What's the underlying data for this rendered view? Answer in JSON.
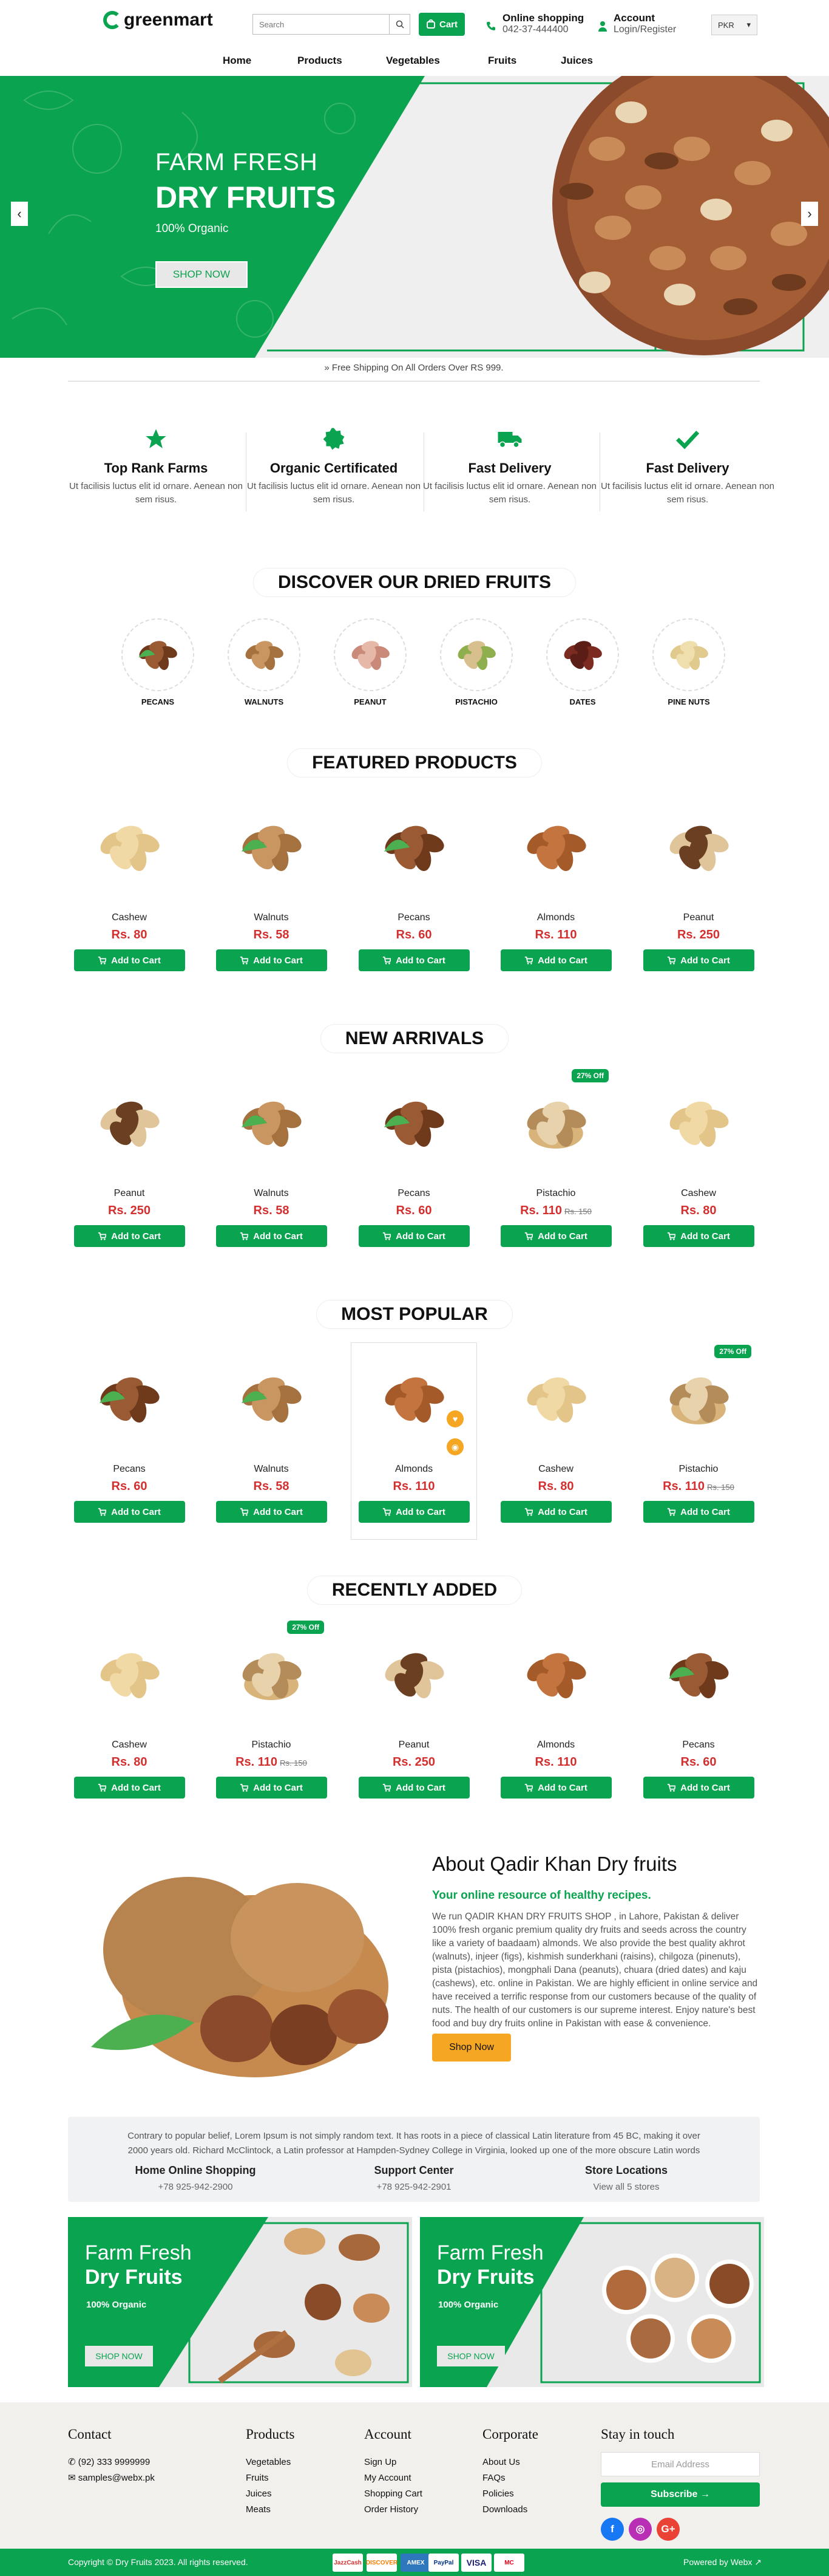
{
  "header": {
    "logo": "greenmart",
    "search_placeholder": "Search",
    "cart_label": "Cart",
    "phone_title": "Online shopping",
    "phone_number": "042-37-444400",
    "account_title": "Account",
    "account_sub": "Login/Register",
    "currency": "PKR"
  },
  "nav": [
    "Home",
    "Products",
    "Vegetables",
    "Fruits",
    "Juices"
  ],
  "hero": {
    "small": "FARM FRESH",
    "big": "DRY FRUITS",
    "sub": "100% Organic",
    "shop": "SHOP NOW"
  },
  "shipping": "» Free Shipping On All Orders Over RS 999.",
  "features": [
    {
      "title": "Top Rank Farms",
      "text": "Ut facilisis luctus elit id ornare. Aenean non sem risus.",
      "icon": "star-icon"
    },
    {
      "title": "Organic Certificated",
      "text": "Ut facilisis luctus elit id ornare. Aenean non sem risus.",
      "icon": "certificate-icon"
    },
    {
      "title": "Fast Delivery",
      "text": "Ut facilisis luctus elit id ornare. Aenean non sem risus.",
      "icon": "truck-icon"
    },
    {
      "title": "Fast Delivery",
      "text": "Ut facilisis luctus elit id ornare. Aenean non sem risus.",
      "icon": "check-icon"
    }
  ],
  "sections": {
    "discover": "DISCOVER OUR DRIED FRUITS",
    "featured": "FEATURED PRODUCTS",
    "new": "NEW ARRIVALS",
    "popular": "MOST POPULAR",
    "recent": "RECENTLY ADDED"
  },
  "categories": [
    "PECANS",
    "WALNUTS",
    "PEANUT",
    "PISTACHIO",
    "DATES",
    "PINE NUTS"
  ],
  "add_to_cart": "Add to Cart",
  "featured": [
    {
      "name": "Cashew",
      "price": "Rs. 80"
    },
    {
      "name": "Walnuts",
      "price": "Rs. 58"
    },
    {
      "name": "Pecans",
      "price": "Rs. 60"
    },
    {
      "name": "Almonds",
      "price": "Rs. 110"
    },
    {
      "name": "Peanut",
      "price": "Rs. 250"
    }
  ],
  "new_arrivals": [
    {
      "name": "Peanut",
      "price": "Rs. 250"
    },
    {
      "name": "Walnuts",
      "price": "Rs. 58"
    },
    {
      "name": "Pecans",
      "price": "Rs. 60"
    },
    {
      "name": "Pistachio",
      "price": "Rs. 110",
      "old": "Rs. 150",
      "badge": "27% Off"
    },
    {
      "name": "Cashew",
      "price": "Rs. 80"
    }
  ],
  "popular": [
    {
      "name": "Pecans",
      "price": "Rs. 60"
    },
    {
      "name": "Walnuts",
      "price": "Rs. 58"
    },
    {
      "name": "Almonds",
      "price": "Rs. 110"
    },
    {
      "name": "Cashew",
      "price": "Rs. 80"
    },
    {
      "name": "Pistachio",
      "price": "Rs. 110",
      "old": "Rs. 150",
      "badge": "27% Off"
    }
  ],
  "recent": [
    {
      "name": "Cashew",
      "price": "Rs. 80"
    },
    {
      "name": "Pistachio",
      "price": "Rs. 110",
      "old": "Rs. 150",
      "badge": "27% Off"
    },
    {
      "name": "Peanut",
      "price": "Rs. 250"
    },
    {
      "name": "Almonds",
      "price": "Rs. 110"
    },
    {
      "name": "Pecans",
      "price": "Rs. 60"
    }
  ],
  "about": {
    "title": "About Qadir Khan Dry fruits",
    "subtitle": "Your online resource of healthy recipes.",
    "body": "We run QADIR KHAN DRY FRUITS SHOP , in Lahore, Pakistan & deliver 100% fresh organic premium quality dry fruits and seeds across the country like a variety of baadaam) almonds. We also provide the best quality akhrot (walnuts), injeer (figs), kishmish sunderkhani (raisins), chilgoza (pinenuts), pista (pistachios), mongphali Dana (peanuts), chuara (dried dates) and kaju (cashews), etc. online in Pakistan. We are highly efficient in online service and have received a terrific response from our customers because of the quality of nuts. The health of our customers is our supreme interest. Enjoy nature's best food and buy dry fruits online in Pakistan with ease & convenience.",
    "button": "Shop Now"
  },
  "support": {
    "text": "Contrary to popular belief, Lorem Ipsum is not simply random text. It has roots in a piece of classical Latin literature from 45 BC, making it over 2000 years old. Richard McClintock, a Latin professor at Hampden-Sydney College in Virginia, looked up one of the more obscure Latin words",
    "cols": [
      {
        "title": "Home Online Shopping",
        "value": "+78 925-942-2900"
      },
      {
        "title": "Support Center",
        "value": "+78 925-942-2901"
      },
      {
        "title": "Store Locations",
        "value": "View all 5 stores"
      }
    ]
  },
  "banners": [
    {
      "t1": "Farm Fresh",
      "t2": "Dry Fruits",
      "t3": "100% Organic",
      "shop": "SHOP NOW"
    },
    {
      "t1": "Farm Fresh",
      "t2": "Dry Fruits",
      "t3": "100% Organic",
      "shop": "SHOP NOW"
    }
  ],
  "footer": {
    "contact_title": "Contact",
    "phone": "(92) 333 9999999",
    "email": "samples@webx.pk",
    "products_title": "Products",
    "products": [
      "Vegetables",
      "Fruits",
      "Juices",
      "Meats"
    ],
    "account_title": "Account",
    "account": [
      "Sign Up",
      "My Account",
      "Shopping Cart",
      "Order History"
    ],
    "corporate_title": "Corporate",
    "corporate": [
      "About Us",
      "FAQs",
      "Policies",
      "Downloads"
    ],
    "touch_title": "Stay in touch",
    "email_placeholder": "Email Address",
    "subscribe": "Subscribe →",
    "copyright": "Copyright © Dry Fruits 2023. All rights reserved.",
    "powered": "Powered by Webx ↗",
    "payments": [
      "JazzCash",
      "DISCOVER",
      "AMEX",
      "PayPal",
      "VISA",
      "MC"
    ]
  },
  "colors": {
    "brand": "#0aa34f",
    "price": "#d32f2f",
    "accent": "#f5a623"
  }
}
